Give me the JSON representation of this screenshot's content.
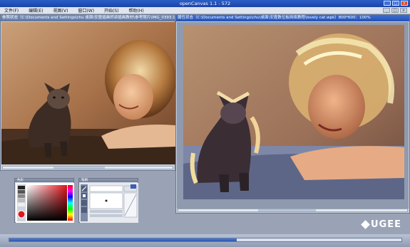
{
  "app": {
    "title": "openCanvas 1.1 - 572"
  },
  "menu": [
    "文件(F)",
    "编辑(E)",
    "视图(V)",
    "窗口(W)",
    "开始(S)",
    "帮助(H)"
  ],
  "source_window": {
    "title": "参照状态（C:\\Documents and Settings\\chu 桌面\\安霆插画师讲插画教材\\参考照片\\IMG_0393.1"
  },
  "paint_window": {
    "title": "属性状态（C:\\Documents and Settings\\chu\\桌面\\安霆数位板网络教程\\lovely cat.wpk）800*600：100%"
  },
  "color_panel": {
    "title": "色彩"
  },
  "brush_panel": {
    "title": "笔刷"
  },
  "progress": {
    "value": 0.58
  },
  "logo": {
    "text": "UGEE"
  },
  "colors": {
    "titlebar": "#2a5fc8",
    "desktop": "#9aa3b6",
    "window_bg": "#c4ccd8"
  },
  "icons": [
    "minimize-icon",
    "maximize-icon",
    "close-icon",
    "pen-icon",
    "eraser-icon"
  ]
}
